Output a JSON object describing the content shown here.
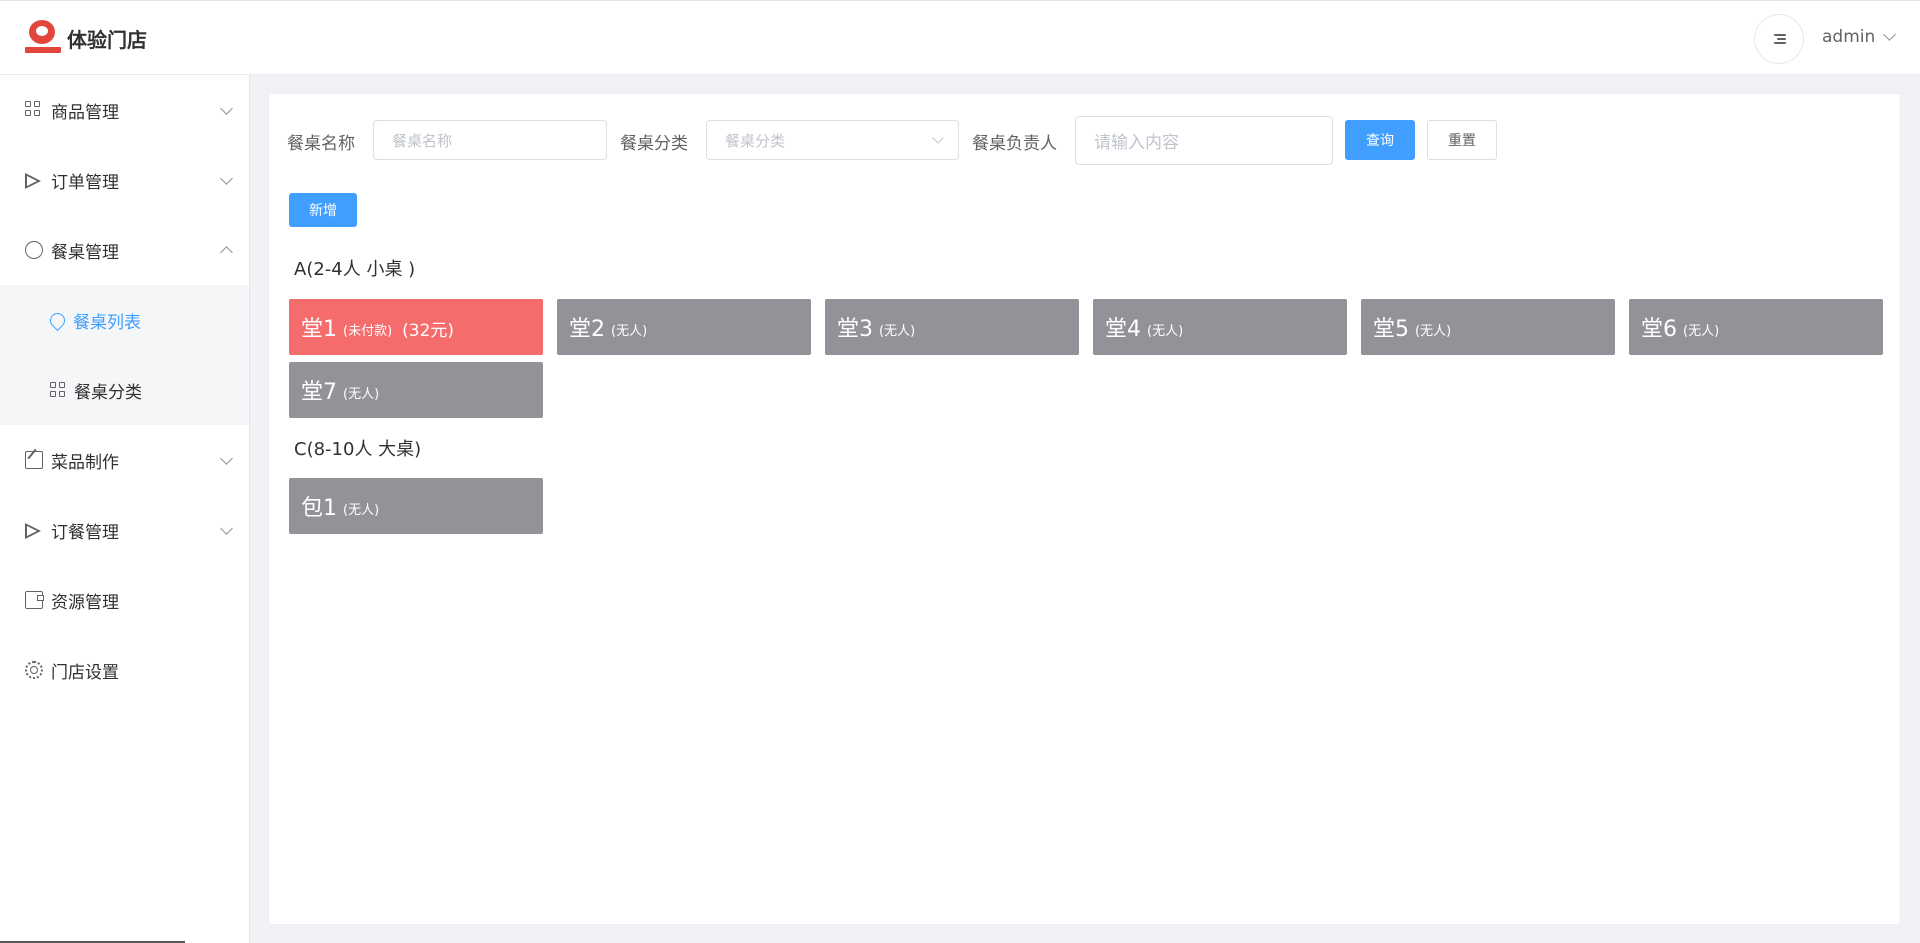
{
  "header": {
    "shop_name": "体验门店",
    "user": "admin"
  },
  "sidebar": {
    "items": [
      {
        "label": "商品管理"
      },
      {
        "label": "订单管理"
      },
      {
        "label": "餐桌管理"
      },
      {
        "label": "菜品制作"
      },
      {
        "label": "订餐管理"
      },
      {
        "label": "资源管理"
      },
      {
        "label": "门店设置"
      }
    ],
    "sub_items": [
      {
        "label": "餐桌列表",
        "active": true
      },
      {
        "label": "餐桌分类"
      }
    ]
  },
  "filters": {
    "name_label": "餐桌名称",
    "name_placeholder": "餐桌名称",
    "category_label": "餐桌分类",
    "category_placeholder": "餐桌分类",
    "owner_label": "餐桌负责人",
    "owner_placeholder": "请输入内容",
    "query_button": "查询",
    "reset_button": "重置"
  },
  "actions": {
    "add_button": "新增"
  },
  "groups": [
    {
      "title": "A(2-4人 小桌 )",
      "tables": [
        {
          "name": "堂1",
          "status": "(未付款)",
          "amount": "(32元)",
          "color": "#f56c6c"
        },
        {
          "name": "堂2",
          "status": "(无人)"
        },
        {
          "name": "堂3",
          "status": "(无人)"
        },
        {
          "name": "堂4",
          "status": "(无人)"
        },
        {
          "name": "堂5",
          "status": "(无人)"
        },
        {
          "name": "堂6",
          "status": "(无人)"
        },
        {
          "name": "堂7",
          "status": "(无人)"
        }
      ]
    },
    {
      "title": "C(8-10人 大桌)",
      "tables": [
        {
          "name": "包1",
          "status": "(无人)"
        }
      ]
    }
  ],
  "colors": {
    "primary": "#409eff",
    "occupied": "#f56c6c",
    "empty": "#919398"
  }
}
